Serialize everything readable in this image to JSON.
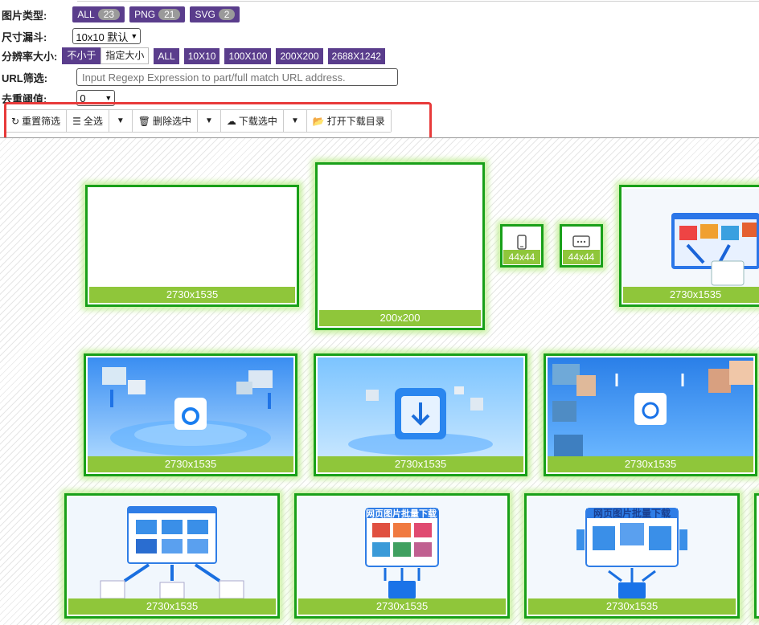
{
  "filters": {
    "type": {
      "label": "图片类型:",
      "chips": [
        {
          "label": "ALL",
          "count": "23"
        },
        {
          "label": "PNG",
          "count": "21"
        },
        {
          "label": "SVG",
          "count": "2"
        }
      ]
    },
    "size_funnel": {
      "label": "尺寸漏斗:",
      "value": "10x10 默认"
    },
    "resolution": {
      "label": "分辨率大小:",
      "toggle": {
        "on": "不小于",
        "off": "指定大小"
      },
      "options": [
        "ALL",
        "10X10",
        "100X100",
        "200X200",
        "2688X1242"
      ]
    },
    "url": {
      "label": "URL筛选:",
      "placeholder": "Input Regexp Expression to part/full match URL address."
    },
    "dedupe": {
      "label": "去重阈值:",
      "value": "0"
    }
  },
  "toolbar": {
    "reset": "重置筛选",
    "select_all": "全选",
    "delete_selected": "删除选中",
    "download_selected": "下载选中",
    "open_folder": "打开下载目录"
  },
  "gallery": {
    "cards": [
      {
        "caption": "2730x1535",
        "content": "blank"
      },
      {
        "caption": "200x200",
        "content": "blank"
      },
      {
        "caption": "44x44",
        "content": "phone-icon"
      },
      {
        "caption": "44x44",
        "content": "chat-icon"
      },
      {
        "caption": "2730x1535",
        "content": "photo-stack-illustration"
      },
      {
        "caption": "2730x1535",
        "content": "app-center-illustration"
      },
      {
        "caption": "2730x1535",
        "content": "download-center-illustration"
      },
      {
        "caption": "2730x1535",
        "content": "photo-wall-illustration"
      },
      {
        "caption": "2730x1535",
        "content": "browser-images-illustration"
      },
      {
        "caption": "2730x1535",
        "content": "batch-download-illustration",
        "overlay_text": "网页图片批量下载"
      },
      {
        "caption": "2730x1535",
        "content": "batch-download-illustration",
        "overlay_text": "网页图片批量下载"
      }
    ]
  },
  "colors": {
    "accent_purple": "#5a3d8c",
    "card_border_green": "#19a019",
    "caption_green": "#8fc63a",
    "highlight_red": "#e83a3a"
  }
}
